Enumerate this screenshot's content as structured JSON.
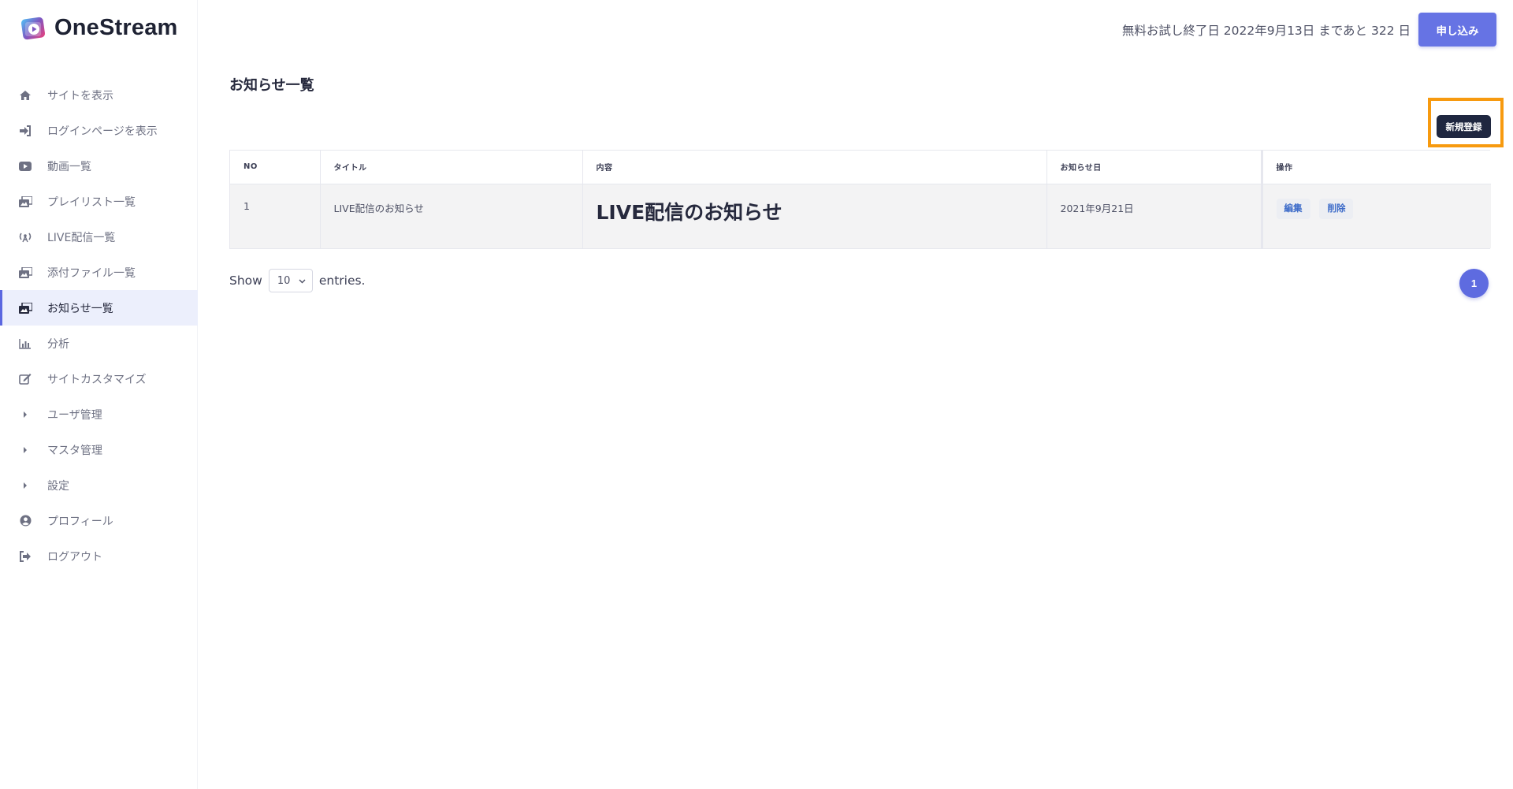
{
  "app": {
    "name": "OneStream",
    "accent_color": "#6673e4",
    "highlight_color": "#f79a0f"
  },
  "header": {
    "trial_text": "無料お試し終了日 2022年9月13日 まであと 322 日",
    "apply_label": "申し込み"
  },
  "sidebar": {
    "items": [
      {
        "label": "サイトを表示",
        "icon": "home-icon"
      },
      {
        "label": "ログインページを表示",
        "icon": "sign-in-icon"
      },
      {
        "label": "動画一覧",
        "icon": "video-icon"
      },
      {
        "label": "プレイリスト一覧",
        "icon": "images-icon"
      },
      {
        "label": "LIVE配信一覧",
        "icon": "broadcast-icon"
      },
      {
        "label": "添付ファイル一覧",
        "icon": "images-icon"
      },
      {
        "label": "お知らせ一覧",
        "icon": "images-icon",
        "active": true
      },
      {
        "label": "分析",
        "icon": "chart-icon"
      },
      {
        "label": "サイトカスタマイズ",
        "icon": "edit-icon"
      },
      {
        "label": "ユーザ管理",
        "icon": "caret-right-icon"
      },
      {
        "label": "マスタ管理",
        "icon": "caret-right-icon"
      },
      {
        "label": "設定",
        "icon": "caret-right-icon"
      },
      {
        "label": "プロフィール",
        "icon": "user-circle-icon"
      },
      {
        "label": "ログアウト",
        "icon": "sign-out-icon"
      }
    ]
  },
  "main": {
    "page_title": "お知らせ一覧",
    "new_button_label": "新規登録",
    "table": {
      "columns": [
        "NO",
        "タイトル",
        "内容",
        "お知らせ日",
        "操作"
      ],
      "rows": [
        {
          "no": "1",
          "title": "LIVE配信のお知らせ",
          "content": "LIVE配信のお知らせ",
          "date": "2021年9月21日",
          "edit_label": "編集",
          "delete_label": "削除"
        }
      ]
    },
    "footer": {
      "show_label": "Show",
      "entries_value": "10",
      "entries_label": "entries.",
      "current_page": "1"
    }
  }
}
